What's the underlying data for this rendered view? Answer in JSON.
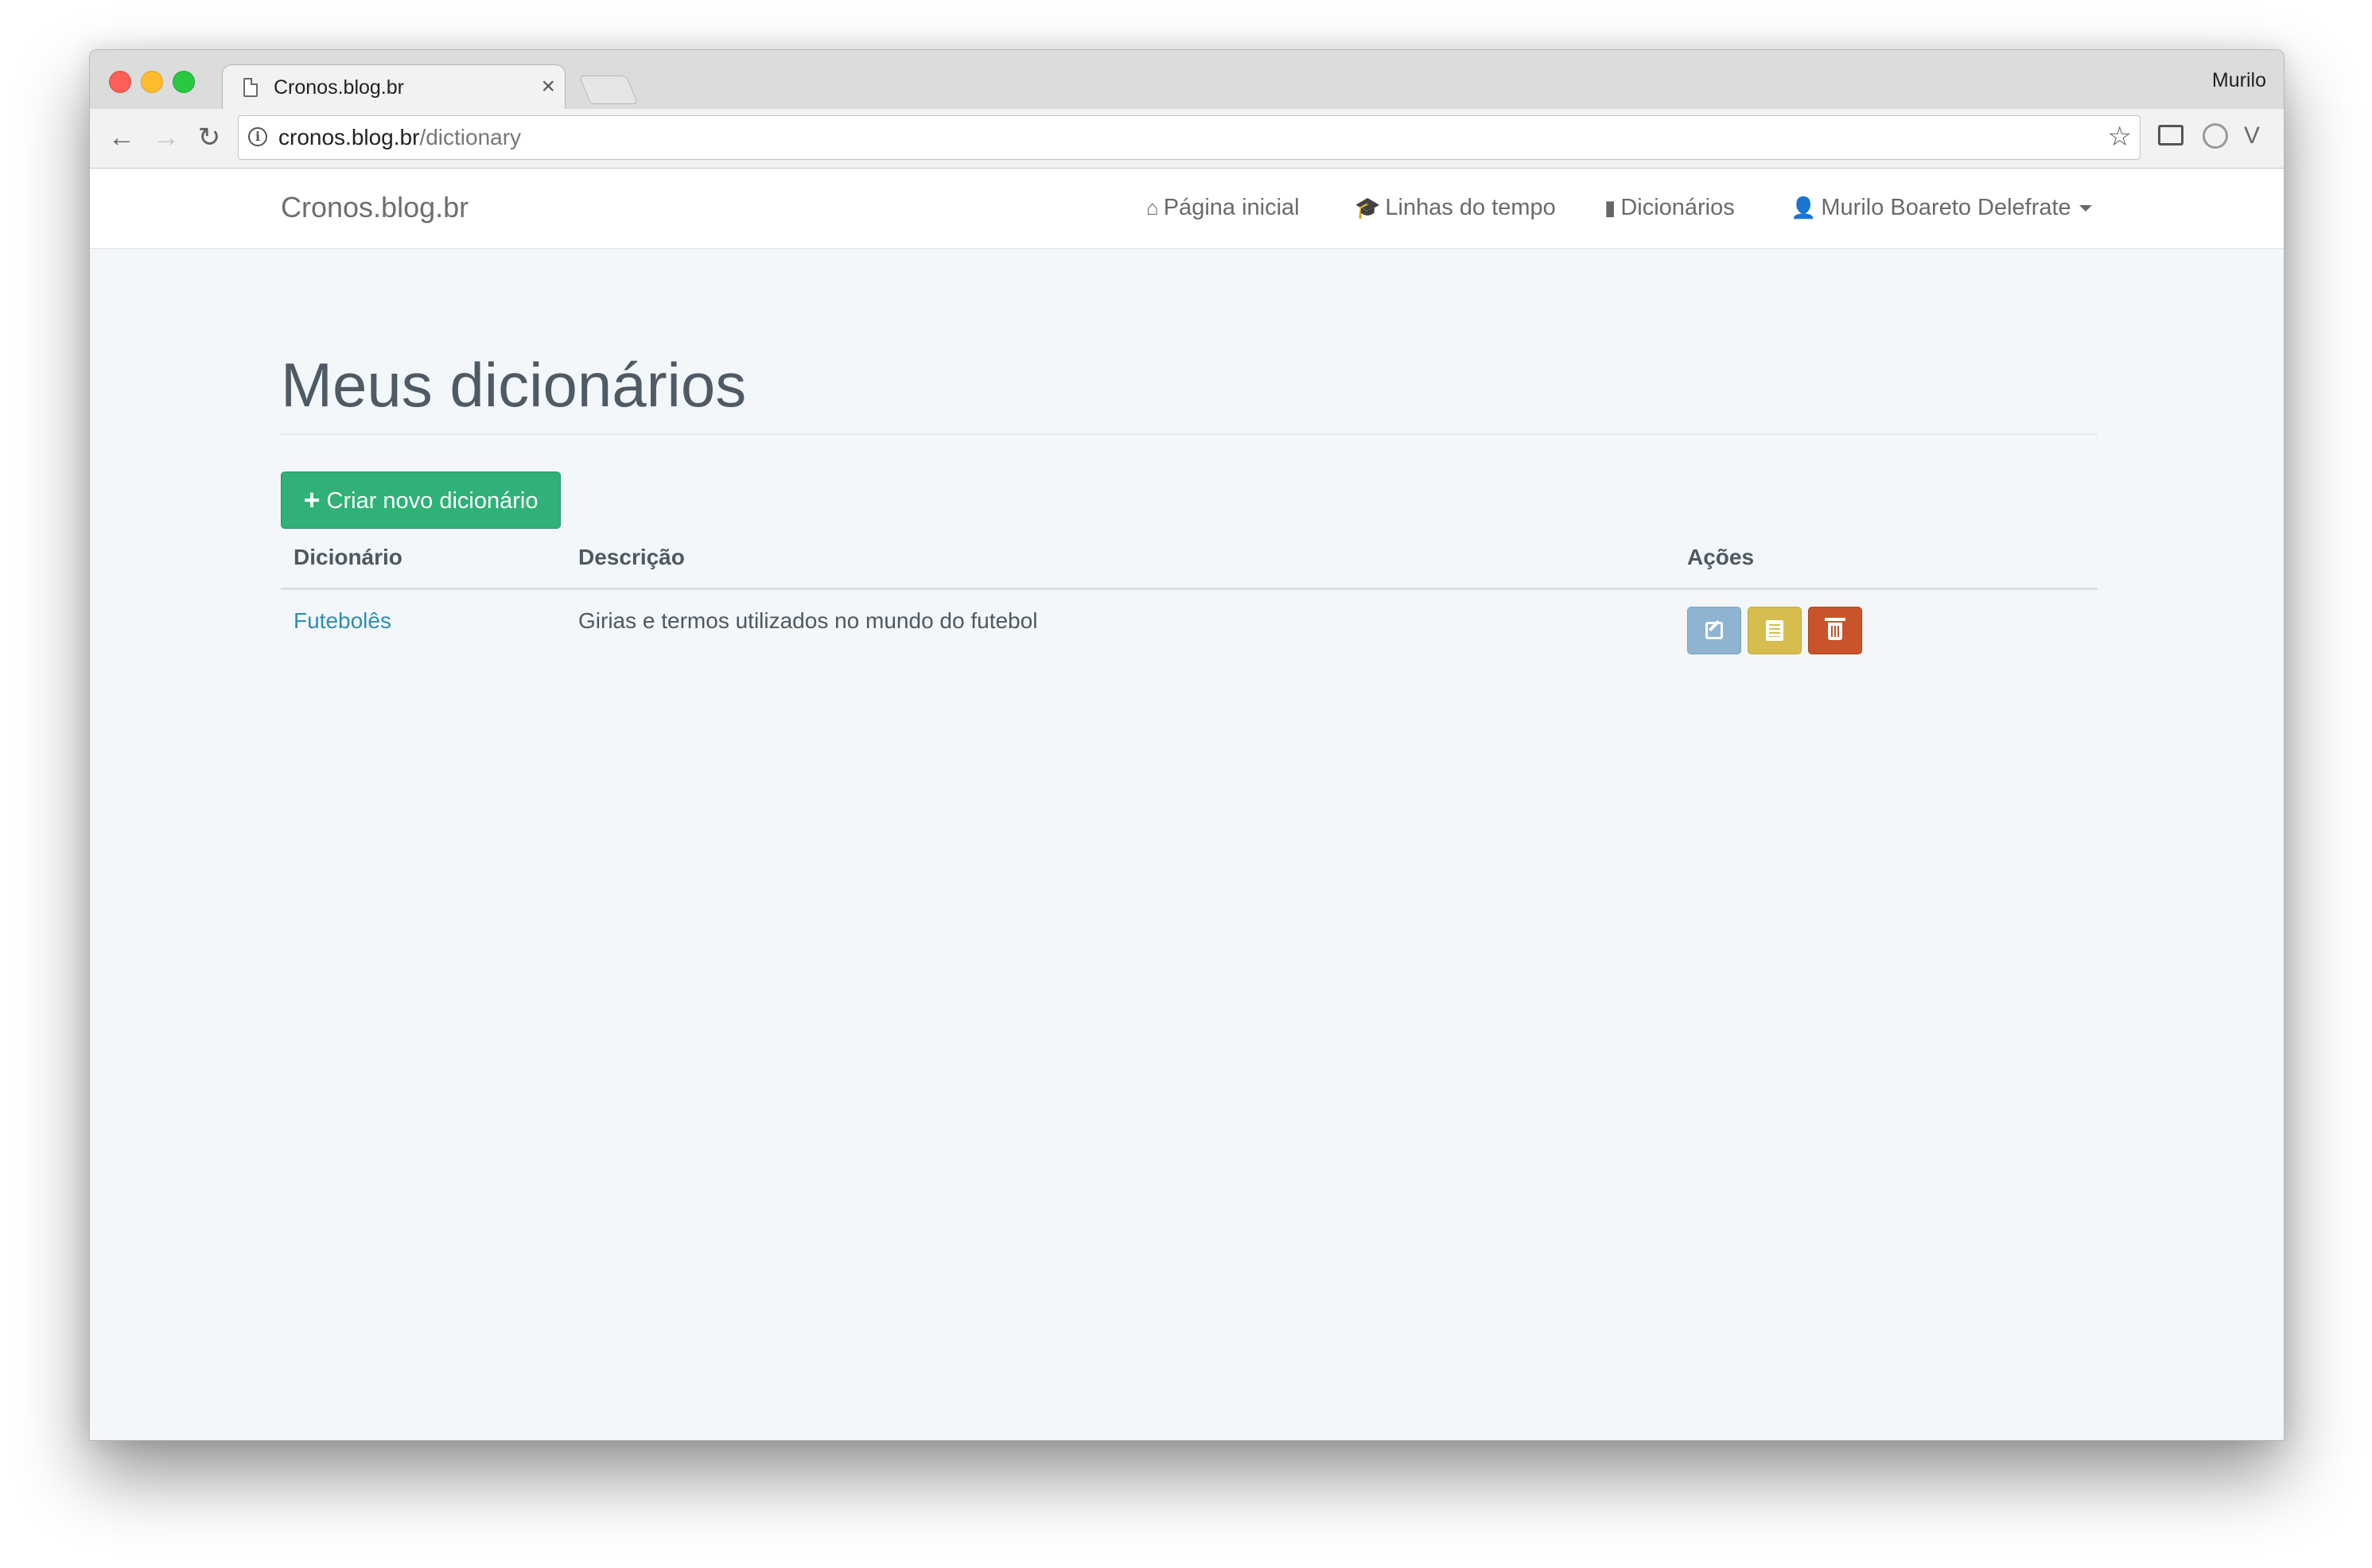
{
  "browser": {
    "tab_title": "Cronos.blog.br",
    "tab_close": "×",
    "profile": "Murilo",
    "url_domain": "cronos.blog.br",
    "url_path": "/dictionary",
    "back_glyph": "←",
    "forward_glyph": "→",
    "reload_glyph": "↻",
    "star_glyph": "☆",
    "ext_v_glyph": "V",
    "menu_glyph": "⋮",
    "info_glyph": "i"
  },
  "navbar": {
    "brand": "Cronos.blog.br",
    "links": [
      {
        "label": "Página inicial",
        "icon": "home-icon",
        "glyph": "⌂"
      },
      {
        "label": "Linhas do tempo",
        "icon": "graduation-cap-icon",
        "glyph": "🎓"
      },
      {
        "label": "Dicionários",
        "icon": "book-icon",
        "glyph": "▮"
      }
    ],
    "user": {
      "label": "Murilo Boareto Delefrate",
      "icon": "user-icon",
      "glyph": "👤"
    }
  },
  "main": {
    "title": "Meus dicionários",
    "create_button": {
      "label": "Criar novo dicionário",
      "icon": "plus-icon",
      "glyph": "+"
    },
    "table": {
      "headers": [
        "Dicionário",
        "Descrição",
        "Ações"
      ],
      "rows": [
        {
          "name": "Futebolês",
          "description": "Girias e termos utilizados no mundo do futebol",
          "actions": [
            "edit-icon",
            "list-icon",
            "trash-icon"
          ]
        }
      ]
    }
  },
  "colors": {
    "create_button": "#2fb178",
    "edit_button": "#8eb4d1",
    "list_button": "#d6bd4e",
    "delete_button": "#c9532b",
    "link": "#2c8fb0"
  }
}
